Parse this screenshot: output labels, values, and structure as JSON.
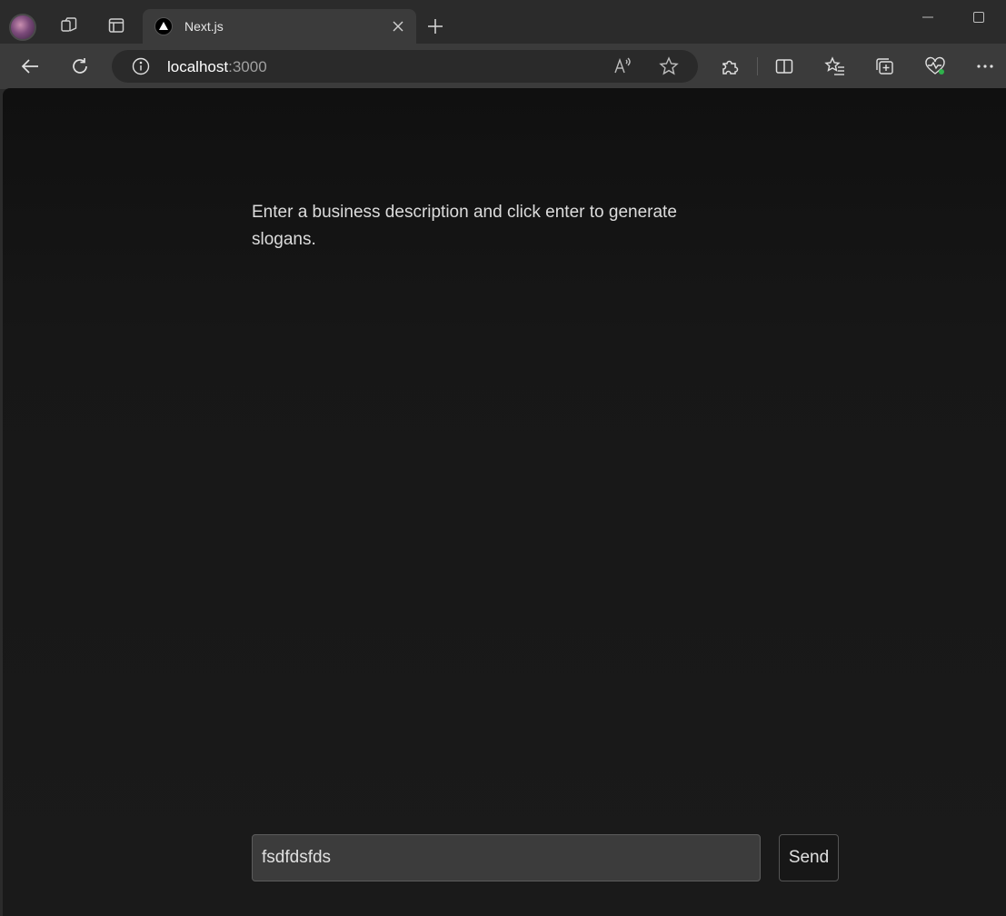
{
  "browser": {
    "tab": {
      "title": "Next.js",
      "favicon": "nextjs-icon"
    },
    "address": {
      "host": "localhost",
      "port": ":3000"
    },
    "icons": {
      "profile": "profile-avatar",
      "workspaces": "workspaces-icon",
      "tab_actions": "tab-actions-icon",
      "close": "close-icon",
      "new_tab": "plus-icon",
      "back": "back-arrow-icon",
      "refresh": "refresh-icon",
      "site_info": "info-icon",
      "read_aloud": "read-aloud-icon",
      "favorite": "star-icon",
      "extensions": "puzzle-icon",
      "split_screen": "split-screen-icon",
      "favorites": "favorites-icon",
      "collections": "collections-icon",
      "health": "heart-pulse-icon",
      "more": "more-icon"
    }
  },
  "page": {
    "intro_text": "Enter a business description and click enter to generate slogans.",
    "input": {
      "value": "fsdfdsfds"
    },
    "send_label": "Send"
  },
  "colors": {
    "page_background": "#171717",
    "browser_chrome": "#2b2b2b",
    "toolbar": "#3b3b3b",
    "input_background": "#3c3c3c"
  }
}
